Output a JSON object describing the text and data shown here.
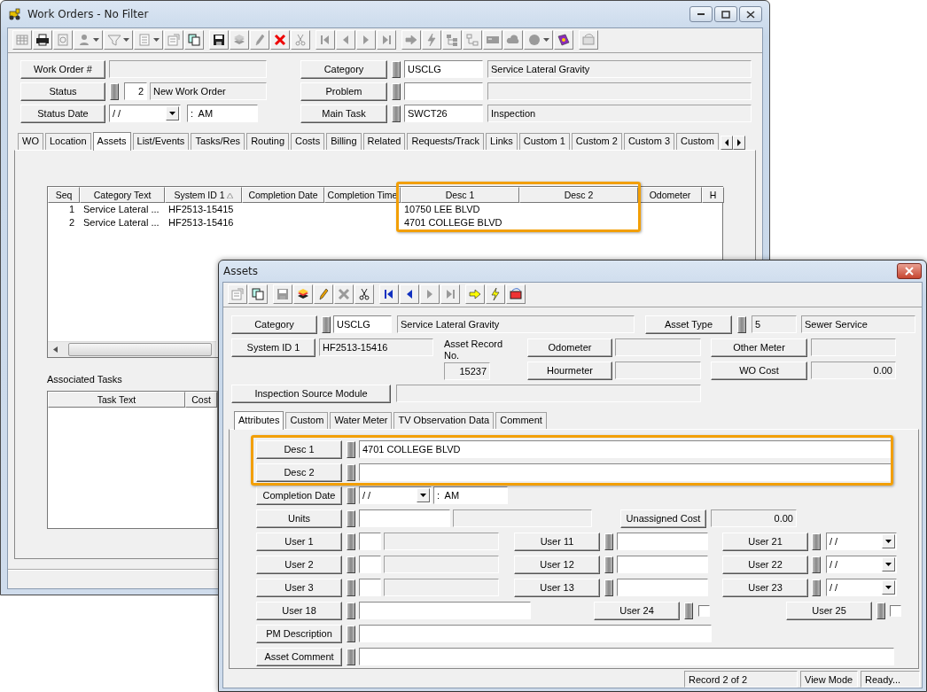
{
  "work_orders_window": {
    "title": "Work Orders - No Filter",
    "toolbar": [
      [
        {
          "disabled": true,
          "dropdown": false
        },
        {
          "disabled": false,
          "dropdown": false
        },
        {
          "disabled": true,
          "dropdown": false
        },
        {
          "disabled": true,
          "dropdown": true
        },
        {
          "disabled": true,
          "dropdown": true
        },
        {
          "disabled": true,
          "dropdown": true
        },
        {
          "disabled": true,
          "dropdown": false
        },
        {
          "disabled": false,
          "dropdown": false
        }
      ],
      [
        {
          "disabled": false,
          "dropdown": false
        },
        {
          "disabled": true,
          "dropdown": false
        },
        {
          "disabled": true,
          "dropdown": false
        },
        {
          "disabled": false,
          "dropdown": false
        },
        {
          "disabled": true,
          "dropdown": false
        }
      ],
      [
        {
          "disabled": true,
          "dropdown": false
        },
        {
          "disabled": true,
          "dropdown": false
        },
        {
          "disabled": true,
          "dropdown": false
        },
        {
          "disabled": true,
          "dropdown": false
        }
      ],
      [
        {
          "disabled": true,
          "dropdown": false
        },
        {
          "disabled": true,
          "dropdown": false
        },
        {
          "disabled": true,
          "dropdown": false
        },
        {
          "disabled": true,
          "dropdown": false
        },
        {
          "disabled": true,
          "dropdown": false
        },
        {
          "disabled": true,
          "dropdown": false
        },
        {
          "disabled": true,
          "dropdown": true
        },
        {
          "disabled": false,
          "dropdown": false
        }
      ],
      [
        {
          "disabled": true,
          "dropdown": false
        }
      ]
    ],
    "form_left": [
      {
        "label": "Work Order #"
      },
      {
        "label": "Status",
        "code": "2",
        "description": "New Work Order"
      },
      {
        "label": "Status Date",
        "date": "/ /",
        "time": ":  AM"
      }
    ],
    "form_right": [
      {
        "label": "Category",
        "code": "USCLG",
        "description": "Service Lateral Gravity"
      },
      {
        "label": "Problem"
      },
      {
        "label": "Main Task",
        "code": "SWCT26",
        "description": "Inspection"
      }
    ],
    "tabs": [
      {
        "label": "WO",
        "selected": false
      },
      {
        "label": "Location",
        "selected": false
      },
      {
        "label": "Assets",
        "selected": true
      },
      {
        "label": "List/Events",
        "selected": false
      },
      {
        "label": "Tasks/Res",
        "selected": false
      },
      {
        "label": "Routing",
        "selected": false
      },
      {
        "label": "Costs",
        "selected": false
      },
      {
        "label": "Billing",
        "selected": false
      },
      {
        "label": "Related",
        "selected": false
      },
      {
        "label": "Requests/Track",
        "selected": false
      },
      {
        "label": "Links",
        "selected": false
      },
      {
        "label": "Custom 1",
        "selected": false
      },
      {
        "label": "Custom 2",
        "selected": false
      },
      {
        "label": "Custom 3",
        "selected": false
      },
      {
        "label": "Custom",
        "selected": false
      }
    ],
    "assets_table": {
      "columns": [
        {
          "label": "Seq",
          "sorted": false
        },
        {
          "label": "Category Text",
          "sorted": false
        },
        {
          "label": "System ID 1",
          "sorted": true
        },
        {
          "label": "Completion Date",
          "sorted": false
        },
        {
          "label": "Completion Time",
          "sorted": false
        },
        {
          "label": "Desc 1",
          "sorted": false
        },
        {
          "label": "Desc 2",
          "sorted": false
        },
        {
          "label": "Odometer",
          "sorted": false
        },
        {
          "label": "H",
          "sorted": false
        }
      ],
      "rows": [
        {
          "seq": "1",
          "category_text": "Service Lateral ...",
          "system_id_1": "HF2513-15415",
          "desc_1": "10750 LEE BLVD"
        },
        {
          "seq": "2",
          "category_text": "Service Lateral ...",
          "system_id_1": "HF2513-15416",
          "desc_1": "4701 COLLEGE BLVD"
        }
      ]
    },
    "associated_tasks": {
      "title": "Associated Tasks",
      "columns": [
        "Task Text",
        "Cost"
      ]
    }
  },
  "assets_window": {
    "title": "Assets",
    "toolbar": [
      [
        {
          "disabled": true,
          "dropdown": false
        },
        {
          "disabled": false,
          "dropdown": false
        }
      ],
      [
        {
          "disabled": true,
          "dropdown": false
        },
        {
          "disabled": false,
          "dropdown": false
        },
        {
          "disabled": false,
          "dropdown": false
        },
        {
          "disabled": true,
          "dropdown": false
        },
        {
          "disabled": false,
          "dropdown": false
        }
      ],
      [
        {
          "disabled": false,
          "dropdown": false
        },
        {
          "disabled": false,
          "dropdown": false
        },
        {
          "disabled": true,
          "dropdown": false
        },
        {
          "disabled": true,
          "dropdown": false
        }
      ],
      [
        {
          "disabled": false,
          "dropdown": false
        },
        {
          "disabled": false,
          "dropdown": false
        },
        {
          "disabled": false,
          "dropdown": false
        }
      ]
    ],
    "category": {
      "label": "Category",
      "code": "USCLG",
      "description": "Service Lateral Gravity"
    },
    "asset_type": {
      "label": "Asset Type",
      "code": "5",
      "description": "Sewer Service"
    },
    "system_id_1": {
      "label": "System ID 1",
      "value": "HF2513-15416"
    },
    "asset_record": {
      "label": "Asset Record No.",
      "value": "15237"
    },
    "odometer": {
      "label": "Odometer"
    },
    "hourmeter": {
      "label": "Hourmeter"
    },
    "other_meter": {
      "label": "Other Meter"
    },
    "wo_cost": {
      "label": "WO Cost",
      "value": "0.00"
    },
    "inspection_source_module": {
      "label": "Inspection Source Module"
    },
    "tabs": [
      {
        "label": "Attributes",
        "selected": true
      },
      {
        "label": "Custom",
        "selected": false
      },
      {
        "label": "Water Meter",
        "selected": false
      },
      {
        "label": "TV Observation Data",
        "selected": false
      },
      {
        "label": "Comment",
        "selected": false
      }
    ],
    "attributes": {
      "desc_1": {
        "label": "Desc 1",
        "value": "4701 COLLEGE BLVD"
      },
      "desc_2": {
        "label": "Desc 2"
      },
      "completion_date": {
        "label": "Completion Date",
        "date": "/ /",
        "time": ":  AM"
      },
      "units": {
        "label": "Units"
      },
      "unassigned_cost": {
        "label": "Unassigned Cost",
        "value": "0.00"
      },
      "user_1": {
        "label": "User 1"
      },
      "user_11": {
        "label": "User 11"
      },
      "user_21": {
        "label": "User 21",
        "date": "/ /"
      },
      "user_2": {
        "label": "User 2"
      },
      "user_12": {
        "label": "User 12"
      },
      "user_22": {
        "label": "User 22",
        "date": "/ /"
      },
      "user_3": {
        "label": "User 3"
      },
      "user_13": {
        "label": "User 13"
      },
      "user_23": {
        "label": "User 23",
        "date": "/ /"
      },
      "user_18": {
        "label": "User 18"
      },
      "user_24": {
        "label": "User 24",
        "checked": false
      },
      "user_25": {
        "label": "User 25",
        "checked": false
      },
      "pm_description": {
        "label": "PM Description"
      },
      "asset_comment": {
        "label": "Asset Comment"
      }
    },
    "status_bar": [
      "Record 2 of 2",
      "View Mode",
      "Ready..."
    ]
  }
}
